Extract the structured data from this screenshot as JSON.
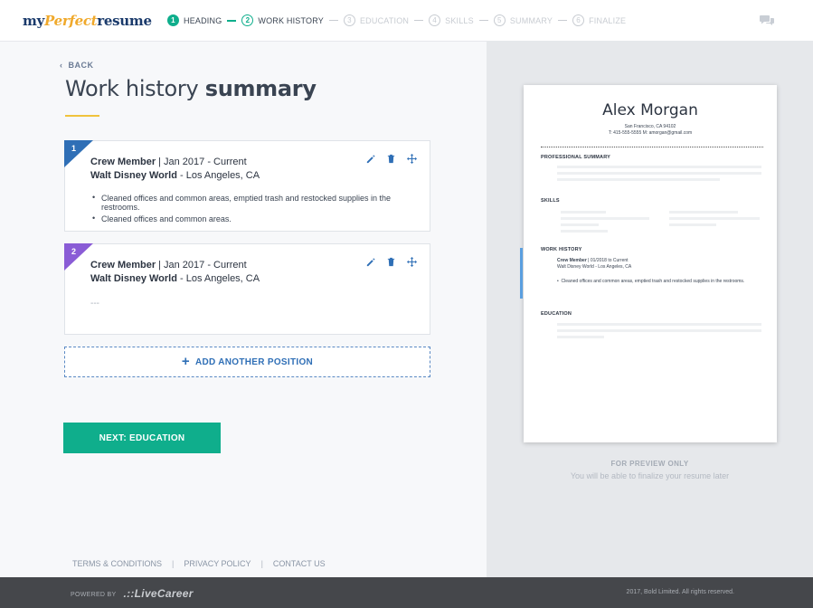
{
  "header": {
    "logo": {
      "part1": "my",
      "part2": "Perfect",
      "part3": "resume"
    },
    "steps": [
      {
        "num": "1",
        "label": "HEADING",
        "state": "done"
      },
      {
        "num": "2",
        "label": "WORK HISTORY",
        "state": "active"
      },
      {
        "num": "3",
        "label": "EDUCATION",
        "state": "todo"
      },
      {
        "num": "4",
        "label": "SKILLS",
        "state": "todo"
      },
      {
        "num": "5",
        "label": "SUMMARY",
        "state": "todo"
      },
      {
        "num": "6",
        "label": "FINALIZE",
        "state": "todo"
      }
    ],
    "chat_icon": "chat-bubbles-icon"
  },
  "page": {
    "back_label": "BACK",
    "title_light": "Work history",
    "title_bold": "summary"
  },
  "positions": [
    {
      "number": "1",
      "ribbon_color": "#2f6fb6",
      "title": "Crew Member",
      "dates": "Jan 2017 - Current",
      "employer": "Walt Disney World",
      "location": "Los Angeles, CA",
      "bullets": [
        "Cleaned offices and common areas, emptied trash and restocked supplies in the restrooms.",
        "Cleaned offices and common areas."
      ]
    },
    {
      "number": "2",
      "ribbon_color": "#8a5cd6",
      "title": "Crew Member",
      "dates": "Jan 2017 - Current",
      "employer": "Walt Disney World",
      "location": "Los Angeles, CA",
      "placeholder": "---"
    }
  ],
  "actions": {
    "add_position": "ADD ANOTHER POSITION",
    "next": "NEXT: EDUCATION"
  },
  "footer_links": [
    "TERMS & CONDITIONS",
    "PRIVACY POLICY",
    "CONTACT US"
  ],
  "preview": {
    "name": "Alex Morgan",
    "address": "San Francisco, CA 94102",
    "contact": "T: 415-555-5555 M: amorgan@gmail.com",
    "sections": {
      "summary": "PROFESSIONAL SUMMARY",
      "skills": "SKILLS",
      "work": "WORK HISTORY",
      "education": "EDUCATION"
    },
    "work_title": "Crew Member",
    "work_dates": "01/2018 to Current",
    "work_employer": "Walt Disney World - Los Angeles, CA",
    "work_bullet": "Cleaned offices and common areas, emptied trash and restocked supplies in the restrooms.",
    "note_title": "FOR PREVIEW ONLY",
    "note_sub": "You will be able to finalize your resume later"
  },
  "bottom": {
    "powered_by": "POWERED BY",
    "brand": ".::LiveCareer",
    "copyright": "2017, Bold Limited. All rights reserved."
  },
  "colors": {
    "accent_green": "#0fae8c",
    "accent_blue": "#2f6fb6",
    "underline_yellow": "#f0c33c"
  }
}
